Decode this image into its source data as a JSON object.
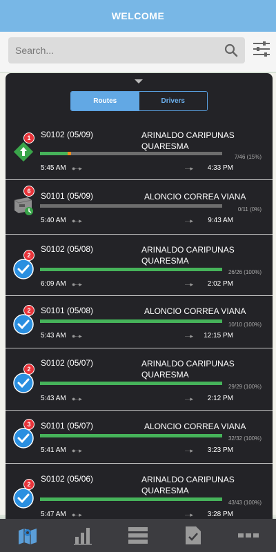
{
  "header": {
    "title": "WELCOME"
  },
  "search": {
    "placeholder": "Search...",
    "value": ""
  },
  "tabs": {
    "routes_label": "Routes",
    "drivers_label": "Drivers",
    "active": "Routes"
  },
  "colors": {
    "header": "#78b7e6",
    "panel": "#232327",
    "progress": "#46b35a",
    "badge": "#e8343a",
    "accent": "#62a8e4"
  },
  "routes": [
    {
      "code": "S0102 (05/09)",
      "driver": "ARINALDO CARIPUNAS QUARESMA",
      "count": "7/46 (15%)",
      "progress": 0.15,
      "start": "5:45 AM",
      "end": "4:33 PM",
      "badge": "1",
      "status": "in-progress-icon"
    },
    {
      "code": "S0101 (05/09)",
      "driver": "ALONCIO CORREA VIANA",
      "count": "0/11 (0%)",
      "progress": 0,
      "start": "5:40 AM",
      "end": "9:43 AM",
      "badge": "6",
      "status": "pending-truck-icon"
    },
    {
      "code": "S0102 (05/08)",
      "driver": "ARINALDO CARIPUNAS QUARESMA",
      "count": "26/26 (100%)",
      "progress": 1,
      "start": "6:09 AM",
      "end": "2:02 PM",
      "badge": "2",
      "status": "completed-check-icon"
    },
    {
      "code": "S0101 (05/08)",
      "driver": "ALONCIO CORREA VIANA",
      "count": "10/10 (100%)",
      "progress": 1,
      "start": "5:43 AM",
      "end": "12:15 PM",
      "badge": "2",
      "status": "completed-check-icon"
    },
    {
      "code": "S0102 (05/07)",
      "driver": "ARINALDO CARIPUNAS QUARESMA",
      "count": "29/29 (100%)",
      "progress": 1,
      "start": "5:43 AM",
      "end": "2:12 PM",
      "badge": "2",
      "status": "completed-check-icon"
    },
    {
      "code": "S0101 (05/07)",
      "driver": "ALONCIO CORREA VIANA",
      "count": "32/32 (100%)",
      "progress": 1,
      "start": "5:41 AM",
      "end": "3:23 PM",
      "badge": "3",
      "status": "completed-check-icon"
    },
    {
      "code": "S0102 (05/06)",
      "driver": "ARINALDO CARIPUNAS QUARESMA",
      "count": "43/43 (100%)",
      "progress": 1,
      "start": "5:47 AM",
      "end": "3:28 PM",
      "badge": "2",
      "status": "completed-check-icon"
    }
  ],
  "nav": [
    {
      "icon": "map-icon"
    },
    {
      "icon": "bar-chart-icon"
    },
    {
      "icon": "list-icon"
    },
    {
      "icon": "checklist-icon"
    },
    {
      "icon": "more-icon"
    }
  ]
}
